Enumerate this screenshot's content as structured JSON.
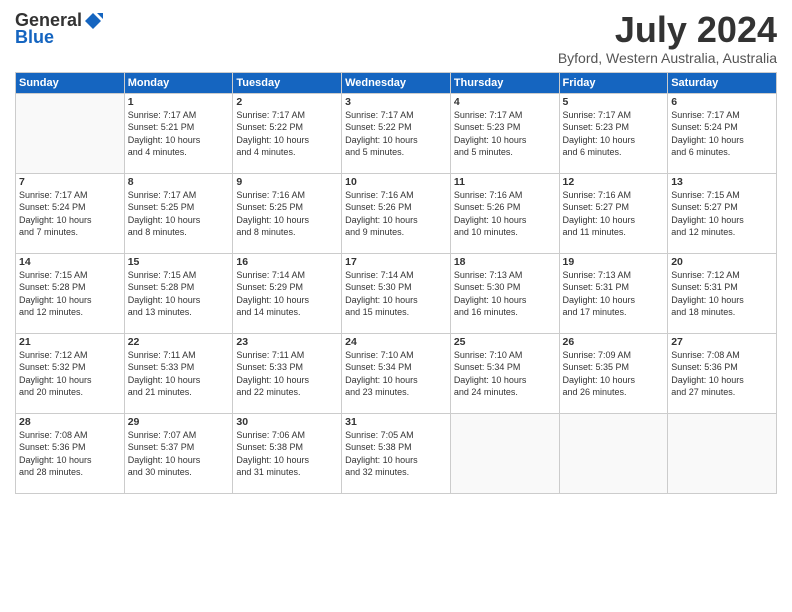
{
  "header": {
    "logo_general": "General",
    "logo_blue": "Blue",
    "title": "July 2024",
    "subtitle": "Byford, Western Australia, Australia"
  },
  "days_of_week": [
    "Sunday",
    "Monday",
    "Tuesday",
    "Wednesday",
    "Thursday",
    "Friday",
    "Saturday"
  ],
  "weeks": [
    [
      {
        "day": "",
        "info": ""
      },
      {
        "day": "1",
        "info": "Sunrise: 7:17 AM\nSunset: 5:21 PM\nDaylight: 10 hours\nand 4 minutes."
      },
      {
        "day": "2",
        "info": "Sunrise: 7:17 AM\nSunset: 5:22 PM\nDaylight: 10 hours\nand 4 minutes."
      },
      {
        "day": "3",
        "info": "Sunrise: 7:17 AM\nSunset: 5:22 PM\nDaylight: 10 hours\nand 5 minutes."
      },
      {
        "day": "4",
        "info": "Sunrise: 7:17 AM\nSunset: 5:23 PM\nDaylight: 10 hours\nand 5 minutes."
      },
      {
        "day": "5",
        "info": "Sunrise: 7:17 AM\nSunset: 5:23 PM\nDaylight: 10 hours\nand 6 minutes."
      },
      {
        "day": "6",
        "info": "Sunrise: 7:17 AM\nSunset: 5:24 PM\nDaylight: 10 hours\nand 6 minutes."
      }
    ],
    [
      {
        "day": "7",
        "info": "Sunrise: 7:17 AM\nSunset: 5:24 PM\nDaylight: 10 hours\nand 7 minutes."
      },
      {
        "day": "8",
        "info": "Sunrise: 7:17 AM\nSunset: 5:25 PM\nDaylight: 10 hours\nand 8 minutes."
      },
      {
        "day": "9",
        "info": "Sunrise: 7:16 AM\nSunset: 5:25 PM\nDaylight: 10 hours\nand 8 minutes."
      },
      {
        "day": "10",
        "info": "Sunrise: 7:16 AM\nSunset: 5:26 PM\nDaylight: 10 hours\nand 9 minutes."
      },
      {
        "day": "11",
        "info": "Sunrise: 7:16 AM\nSunset: 5:26 PM\nDaylight: 10 hours\nand 10 minutes."
      },
      {
        "day": "12",
        "info": "Sunrise: 7:16 AM\nSunset: 5:27 PM\nDaylight: 10 hours\nand 11 minutes."
      },
      {
        "day": "13",
        "info": "Sunrise: 7:15 AM\nSunset: 5:27 PM\nDaylight: 10 hours\nand 12 minutes."
      }
    ],
    [
      {
        "day": "14",
        "info": "Sunrise: 7:15 AM\nSunset: 5:28 PM\nDaylight: 10 hours\nand 12 minutes."
      },
      {
        "day": "15",
        "info": "Sunrise: 7:15 AM\nSunset: 5:28 PM\nDaylight: 10 hours\nand 13 minutes."
      },
      {
        "day": "16",
        "info": "Sunrise: 7:14 AM\nSunset: 5:29 PM\nDaylight: 10 hours\nand 14 minutes."
      },
      {
        "day": "17",
        "info": "Sunrise: 7:14 AM\nSunset: 5:30 PM\nDaylight: 10 hours\nand 15 minutes."
      },
      {
        "day": "18",
        "info": "Sunrise: 7:13 AM\nSunset: 5:30 PM\nDaylight: 10 hours\nand 16 minutes."
      },
      {
        "day": "19",
        "info": "Sunrise: 7:13 AM\nSunset: 5:31 PM\nDaylight: 10 hours\nand 17 minutes."
      },
      {
        "day": "20",
        "info": "Sunrise: 7:12 AM\nSunset: 5:31 PM\nDaylight: 10 hours\nand 18 minutes."
      }
    ],
    [
      {
        "day": "21",
        "info": "Sunrise: 7:12 AM\nSunset: 5:32 PM\nDaylight: 10 hours\nand 20 minutes."
      },
      {
        "day": "22",
        "info": "Sunrise: 7:11 AM\nSunset: 5:33 PM\nDaylight: 10 hours\nand 21 minutes."
      },
      {
        "day": "23",
        "info": "Sunrise: 7:11 AM\nSunset: 5:33 PM\nDaylight: 10 hours\nand 22 minutes."
      },
      {
        "day": "24",
        "info": "Sunrise: 7:10 AM\nSunset: 5:34 PM\nDaylight: 10 hours\nand 23 minutes."
      },
      {
        "day": "25",
        "info": "Sunrise: 7:10 AM\nSunset: 5:34 PM\nDaylight: 10 hours\nand 24 minutes."
      },
      {
        "day": "26",
        "info": "Sunrise: 7:09 AM\nSunset: 5:35 PM\nDaylight: 10 hours\nand 26 minutes."
      },
      {
        "day": "27",
        "info": "Sunrise: 7:08 AM\nSunset: 5:36 PM\nDaylight: 10 hours\nand 27 minutes."
      }
    ],
    [
      {
        "day": "28",
        "info": "Sunrise: 7:08 AM\nSunset: 5:36 PM\nDaylight: 10 hours\nand 28 minutes."
      },
      {
        "day": "29",
        "info": "Sunrise: 7:07 AM\nSunset: 5:37 PM\nDaylight: 10 hours\nand 30 minutes."
      },
      {
        "day": "30",
        "info": "Sunrise: 7:06 AM\nSunset: 5:38 PM\nDaylight: 10 hours\nand 31 minutes."
      },
      {
        "day": "31",
        "info": "Sunrise: 7:05 AM\nSunset: 5:38 PM\nDaylight: 10 hours\nand 32 minutes."
      },
      {
        "day": "",
        "info": ""
      },
      {
        "day": "",
        "info": ""
      },
      {
        "day": "",
        "info": ""
      }
    ]
  ]
}
